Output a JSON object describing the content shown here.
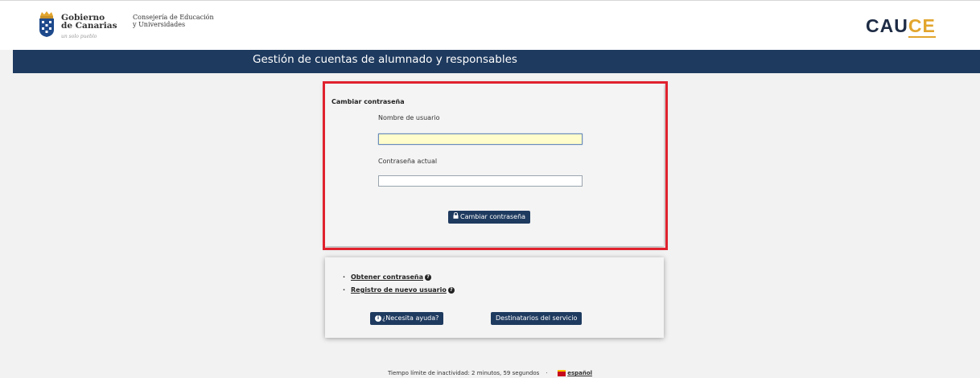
{
  "header": {
    "gobierno_line1": "Gobierno",
    "gobierno_line2": "de Canarias",
    "gobierno_sub": "un solo pueblo",
    "consejeria_line1": "Consejería de Educación",
    "consejeria_line2": "y Universidades",
    "app_logo_main": "CAU",
    "app_logo_accent": "CE"
  },
  "navbar": {
    "title": "Gestión de cuentas de alumnado y responsables"
  },
  "login": {
    "title": "Cambiar contraseña",
    "username_label": "Nombre de usuario",
    "username_value": "",
    "password_label": "Contraseña actual",
    "password_value": "",
    "submit_label": "Cambiar contraseña",
    "submit_icon": "lock-icon"
  },
  "links": {
    "items": [
      {
        "label": "Obtener contraseña",
        "icon": "question-circle-icon"
      },
      {
        "label": "Registro de nuevo usuario",
        "icon": "question-circle-icon"
      }
    ],
    "help_button": "¿Necesita ayuda?",
    "help_icon": "info-circle-icon",
    "recipients_button": "Destinatarios del servicio"
  },
  "footer": {
    "inactivity_text": "Tiempo límite de inactividad: 2 minutos, 59 segundos",
    "separator": "·",
    "language": "español",
    "language_flag": "spain-flag-icon"
  },
  "colors": {
    "navbar": "#1e3a5f",
    "highlight_frame": "#e0222e",
    "logo_accent": "#e2a52d",
    "active_field": "#fffdcb"
  }
}
